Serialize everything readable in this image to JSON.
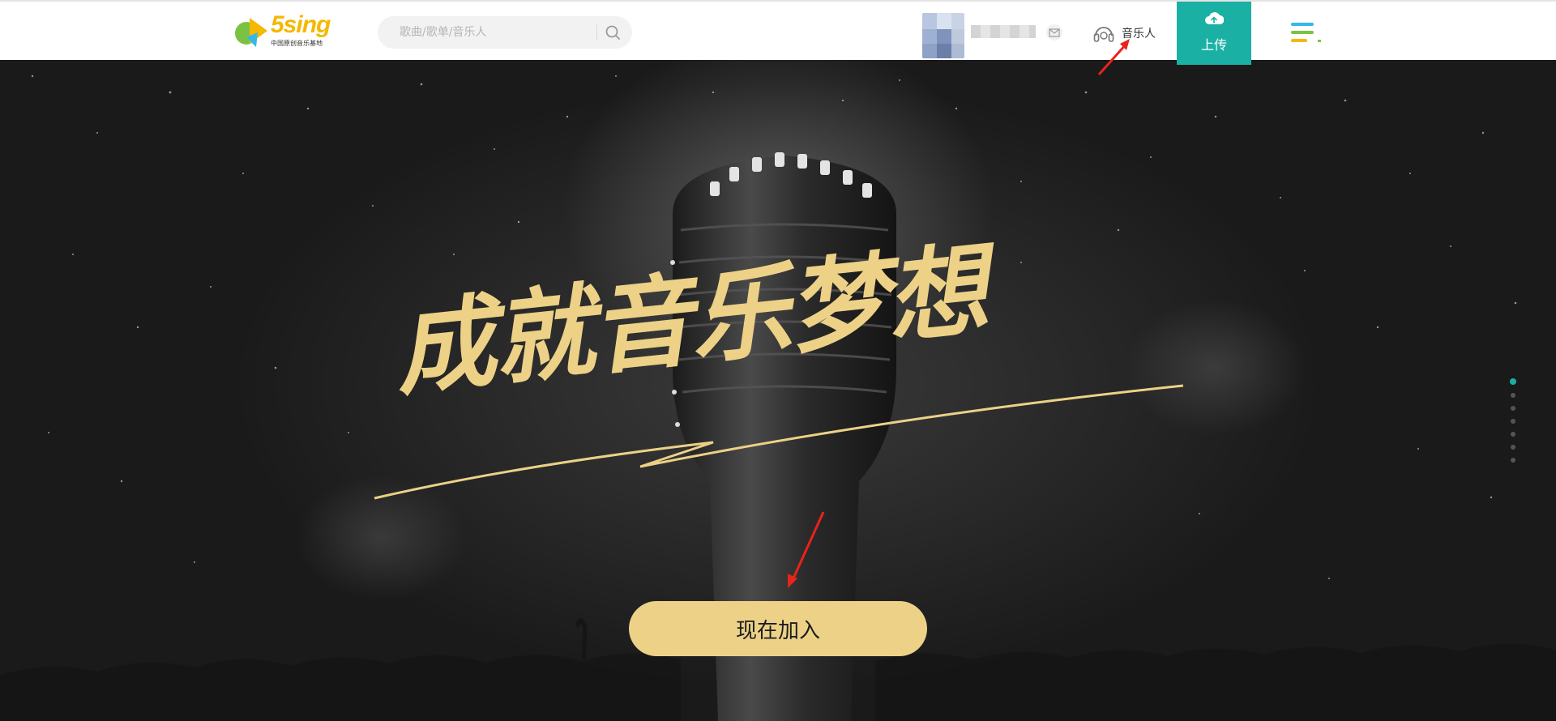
{
  "header": {
    "logo": {
      "text": "5sing",
      "subtitle": "中国原创音乐基地"
    },
    "search": {
      "placeholder": "歌曲/歌单/音乐人",
      "value": ""
    },
    "musician_label": "音乐人",
    "upload_label": "上传"
  },
  "hero": {
    "slogan": "成就音乐梦想",
    "join_button": "现在加入",
    "pager": {
      "count": 7,
      "active_index": 0
    }
  },
  "colors": {
    "accent": "#1ab1a4",
    "gold": "#ecd187",
    "annotation_arrow": "#e8231c"
  },
  "icons": [
    "logo-icon",
    "search-icon",
    "mail-icon",
    "headphones-icon",
    "cloud-upload-icon",
    "menu-icon"
  ]
}
